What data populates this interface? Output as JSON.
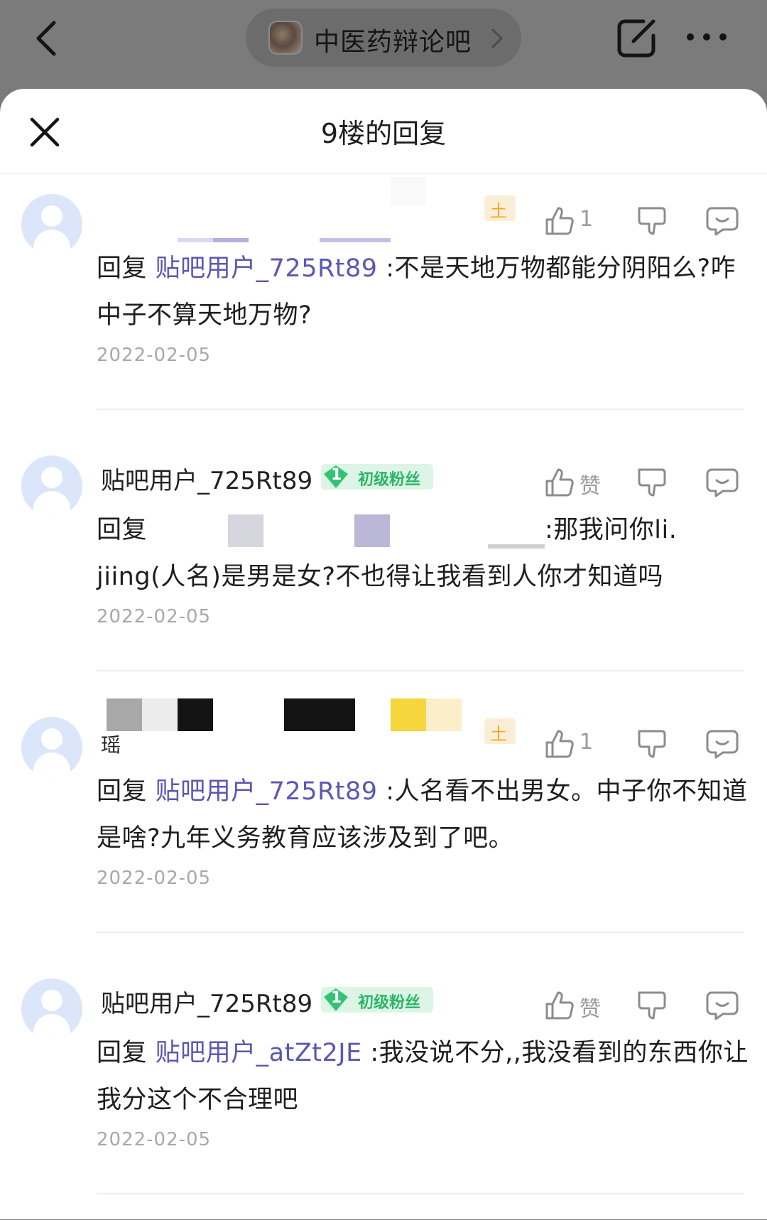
{
  "topbar": {
    "forum_name": "中医药辩论吧"
  },
  "sheet": {
    "title": "9楼的回复"
  },
  "replies": [
    {
      "username": "",
      "fan_badge": null,
      "like_label": "1",
      "reply_prefix": "回复",
      "mention": "贴吧用户_725Rt89",
      "text": ":不是天地万物都能分阴阳么?咋中子不算天地万物?",
      "date": "2022-02-05"
    },
    {
      "username": "贴吧用户_725Rt89",
      "fan_badge": {
        "level": "1",
        "label": "初级粉丝"
      },
      "like_label": "赞",
      "reply_prefix": "回复",
      "mention": "",
      "text": ":那我问你li. jiing(人名)是男是女?不也得让我看到人你才知道吗",
      "date": "2022-02-05"
    },
    {
      "username": "瑶",
      "fan_badge": null,
      "like_label": "1",
      "reply_prefix": "回复",
      "mention": "贴吧用户_725Rt89",
      "text": ":人名看不出男女。中子你不知道是啥?九年义务教育应该涉及到了吧。",
      "date": "2022-02-05"
    },
    {
      "username": "贴吧用户_725Rt89",
      "fan_badge": {
        "level": "1",
        "label": "初级粉丝"
      },
      "like_label": "赞",
      "reply_prefix": "回复",
      "mention": "贴吧用户_atZt2JE",
      "text": ":我没说不分,,我没看到的东西你让我分这个不合理吧",
      "date": "2022-02-05"
    }
  ],
  "colors": {
    "mention": "#5b57b3",
    "date": "#a8a8a8",
    "badge_green": "#2cb567",
    "level_yellow": "#f5a623"
  }
}
